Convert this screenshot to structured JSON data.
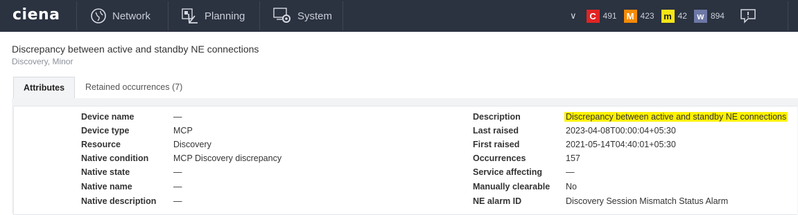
{
  "topbar": {
    "logo": "ciena",
    "nav": [
      {
        "label": "Network",
        "icon": "globe-icon"
      },
      {
        "label": "Planning",
        "icon": "planning-icon"
      },
      {
        "label": "System",
        "icon": "system-gear-icon"
      }
    ],
    "alarms": [
      {
        "letter": "C",
        "count": "491",
        "color": "#e02424",
        "text_color": "#ffffff"
      },
      {
        "letter": "M",
        "count": "423",
        "color": "#f58a07",
        "text_color": "#ffffff"
      },
      {
        "letter": "m",
        "count": "42",
        "color": "#f5e616",
        "text_color": "#222222"
      },
      {
        "letter": "w",
        "count": "894",
        "color": "#6d78a6",
        "text_color": "#ffffff"
      }
    ]
  },
  "header": {
    "title": "Discrepancy between active and standby NE connections",
    "subtitle": "Discovery, Minor"
  },
  "tabs": [
    {
      "label": "Attributes",
      "active": true
    },
    {
      "label": "Retained occurrences (7)",
      "active": false
    }
  ],
  "attributes": {
    "left": [
      {
        "label": "Device name",
        "value": "—"
      },
      {
        "label": "Device type",
        "value": "MCP"
      },
      {
        "label": "Resource",
        "value": "Discovery"
      },
      {
        "label": "Native condition",
        "value": "MCP Discovery discrepancy"
      },
      {
        "label": "Native state",
        "value": "—"
      },
      {
        "label": "Native name",
        "value": "—"
      },
      {
        "label": "Native description",
        "value": "—"
      }
    ],
    "right": [
      {
        "label": "Description",
        "value": "Discrepancy between active and standby NE connections"
      },
      {
        "label": "Last raised",
        "value": "2023-04-08T00:00:04+05:30"
      },
      {
        "label": "First raised",
        "value": "2021-05-14T04:40:01+05:30"
      },
      {
        "label": "Occurrences",
        "value": "157"
      },
      {
        "label": "Service affecting",
        "value": "—"
      },
      {
        "label": "Manually clearable",
        "value": "No"
      },
      {
        "label": "NE alarm ID",
        "value": "Discovery Session Mismatch Status Alarm"
      }
    ]
  },
  "colors": {
    "topbar": "#2b3240",
    "highlight": "#fff200"
  }
}
